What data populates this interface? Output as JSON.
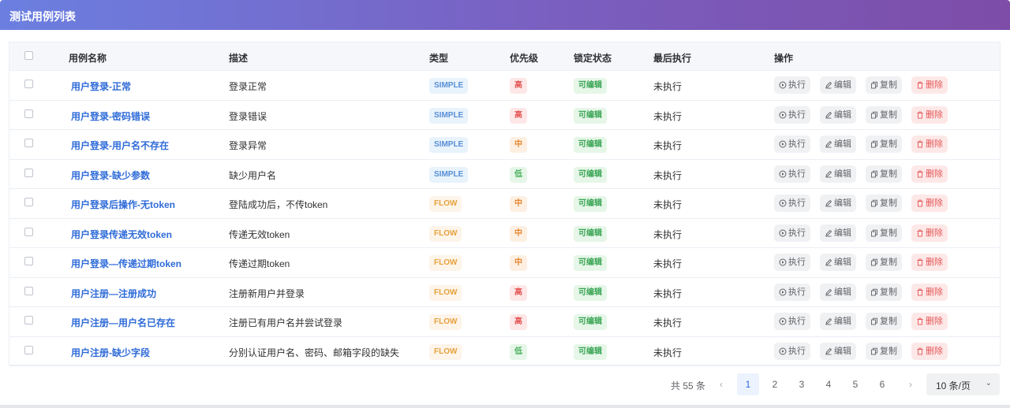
{
  "header": {
    "title": "测试用例列表"
  },
  "table": {
    "columns": {
      "name": "用例名称",
      "desc": "描述",
      "type": "类型",
      "priority": "优先级",
      "lock": "锁定状态",
      "last_run": "最后执行",
      "actions": "操作"
    },
    "actions": {
      "run": "执行",
      "edit": "编辑",
      "copy": "复制",
      "delete": "删除"
    },
    "rows": [
      {
        "name": "用户登录-正常",
        "desc": "登录正常",
        "type": "SIMPLE",
        "priority": "高",
        "lock": "可编辑",
        "last_run": "未执行"
      },
      {
        "name": "用户登录-密码错误",
        "desc": "登录错误",
        "type": "SIMPLE",
        "priority": "高",
        "lock": "可编辑",
        "last_run": "未执行"
      },
      {
        "name": "用户登录-用户名不存在",
        "desc": "登录异常",
        "type": "SIMPLE",
        "priority": "中",
        "lock": "可编辑",
        "last_run": "未执行"
      },
      {
        "name": "用户登录-缺少参数",
        "desc": "缺少用户名",
        "type": "SIMPLE",
        "priority": "低",
        "lock": "可编辑",
        "last_run": "未执行"
      },
      {
        "name": "用户登录后操作-无token",
        "desc": "登陆成功后，不传token",
        "type": "FLOW",
        "priority": "中",
        "lock": "可编辑",
        "last_run": "未执行"
      },
      {
        "name": "用户登录传递无效token",
        "desc": "传递无效token",
        "type": "FLOW",
        "priority": "中",
        "lock": "可编辑",
        "last_run": "未执行"
      },
      {
        "name": "用户登录—传递过期token",
        "desc": "传递过期token",
        "type": "FLOW",
        "priority": "中",
        "lock": "可编辑",
        "last_run": "未执行"
      },
      {
        "name": "用户注册—注册成功",
        "desc": "注册新用户并登录",
        "type": "FLOW",
        "priority": "高",
        "lock": "可编辑",
        "last_run": "未执行"
      },
      {
        "name": "用户注册—用户名已存在",
        "desc": "注册已有用户名并尝试登录",
        "type": "FLOW",
        "priority": "高",
        "lock": "可编辑",
        "last_run": "未执行"
      },
      {
        "name": "用户注册-缺少字段",
        "desc": "分别认证用户名、密码、邮箱字段的缺失",
        "type": "FLOW",
        "priority": "低",
        "lock": "可编辑",
        "last_run": "未执行"
      }
    ]
  },
  "pagination": {
    "total": "共 55 条",
    "pages": [
      "1",
      "2",
      "3",
      "4",
      "5",
      "6"
    ],
    "current": "1",
    "page_size": "10 条/页"
  }
}
